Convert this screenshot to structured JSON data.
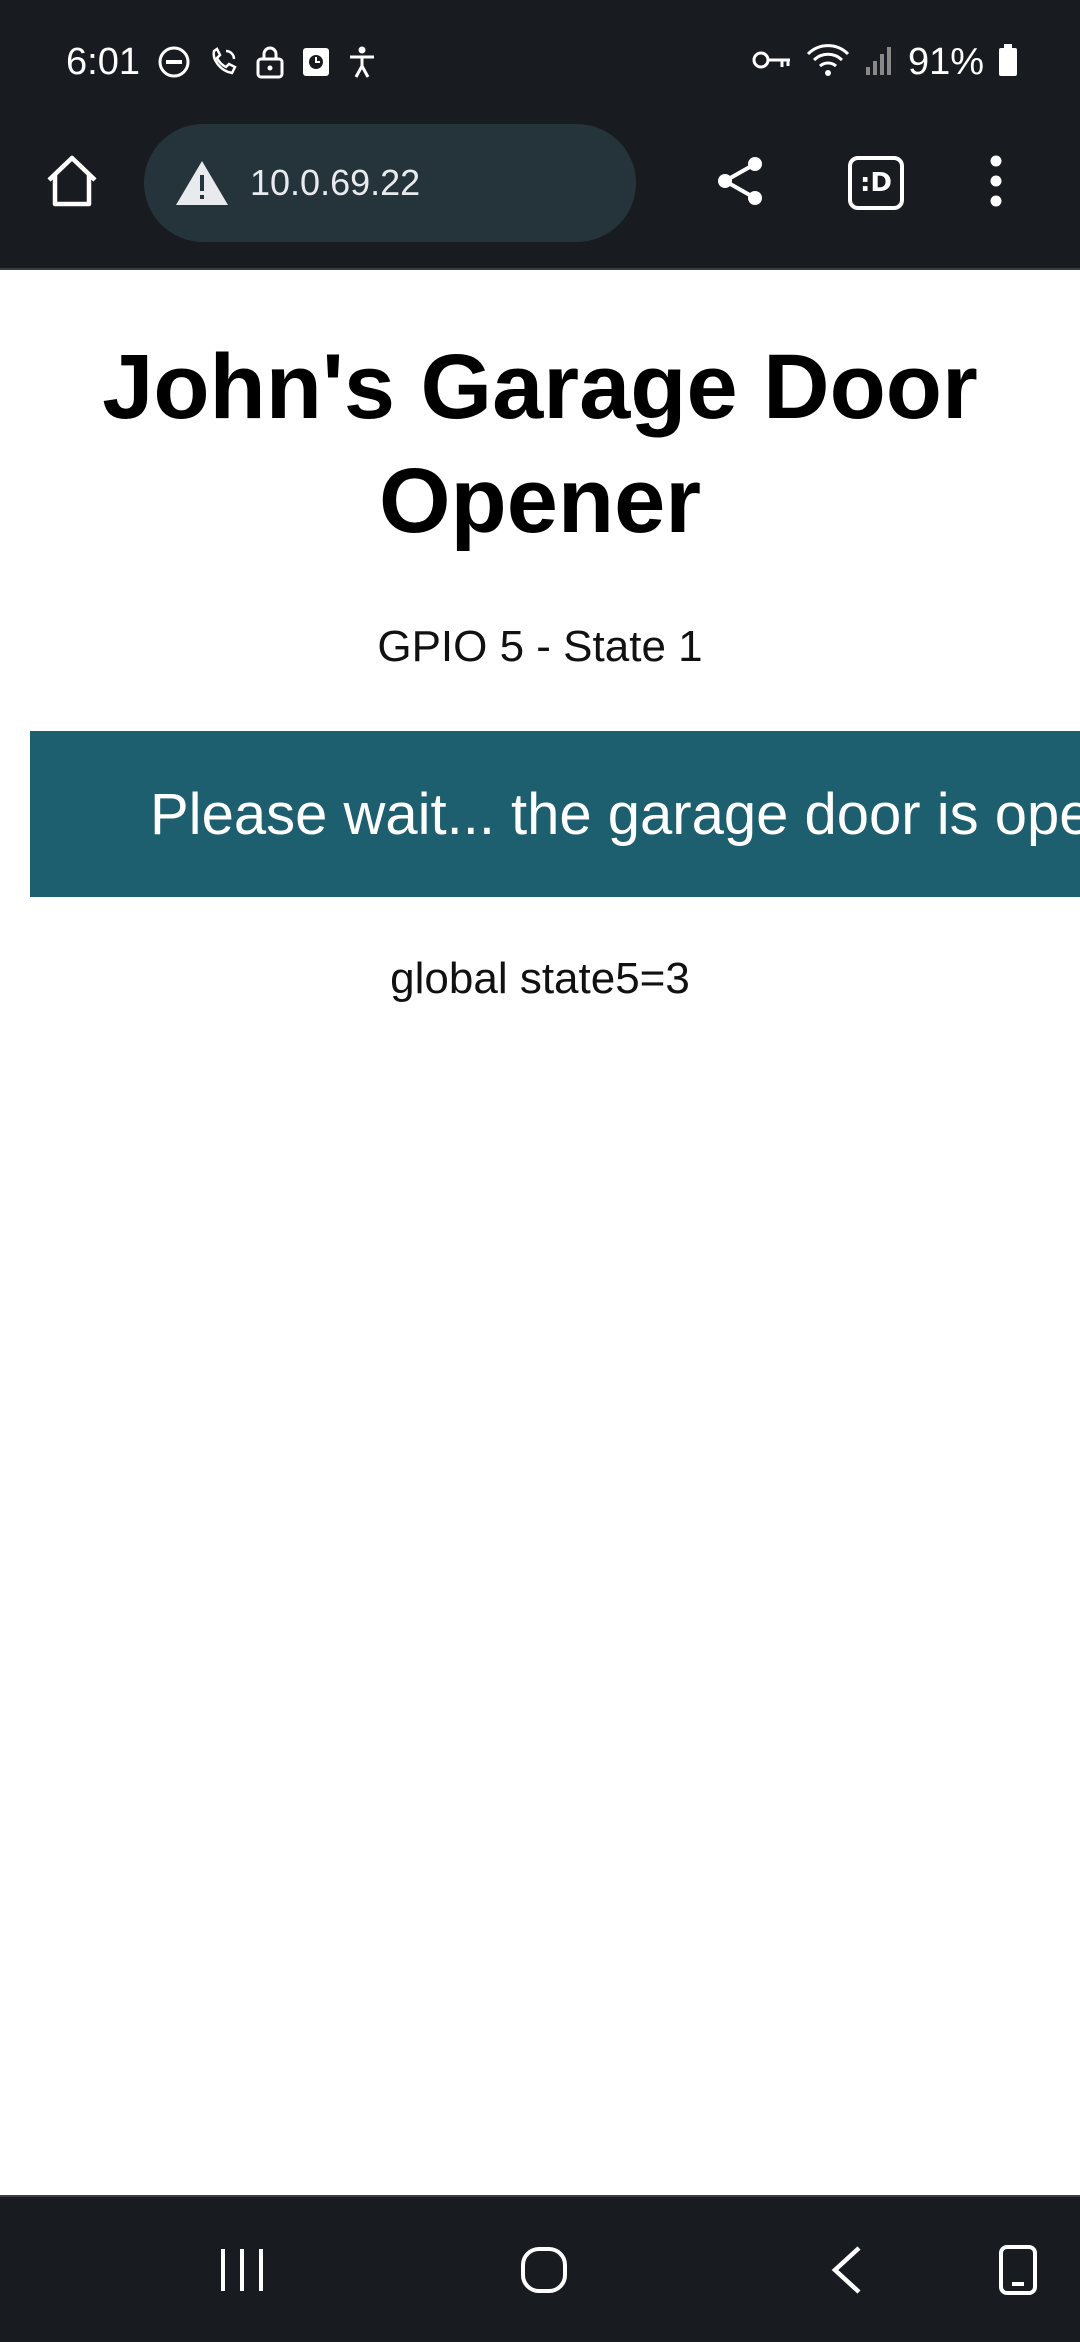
{
  "status_bar": {
    "time": "6:01",
    "battery_percent": "91%",
    "left_icons": [
      "do-not-disturb-icon",
      "wifi-calling-icon",
      "lock-icon",
      "screen-record-icon",
      "accessibility-icon"
    ],
    "right_icons": [
      "vpn-key-icon",
      "wifi-icon",
      "cell-signal-icon",
      "battery-icon"
    ]
  },
  "browser": {
    "url": "10.0.69.22",
    "toolbar_icons": [
      "home-icon",
      "warning-icon",
      "share-icon",
      "tab-switcher-icon",
      "more-options-icon"
    ],
    "tab_switcher_label": ":D"
  },
  "page": {
    "title": "John's Garage Door Opener",
    "gpio_state": "GPIO 5 - State 1",
    "wait_button_label": "Please wait... the garage door is opening",
    "global_state": "global state5=3"
  },
  "colors": {
    "system_bar": "#181b1f",
    "url_pill": "#25333b",
    "button_bg": "#1d5f6f",
    "button_text": "#ffffff"
  },
  "nav_bar": {
    "buttons": [
      "recent-apps-icon",
      "home-nav-icon",
      "back-icon",
      "rotate-icon"
    ]
  }
}
